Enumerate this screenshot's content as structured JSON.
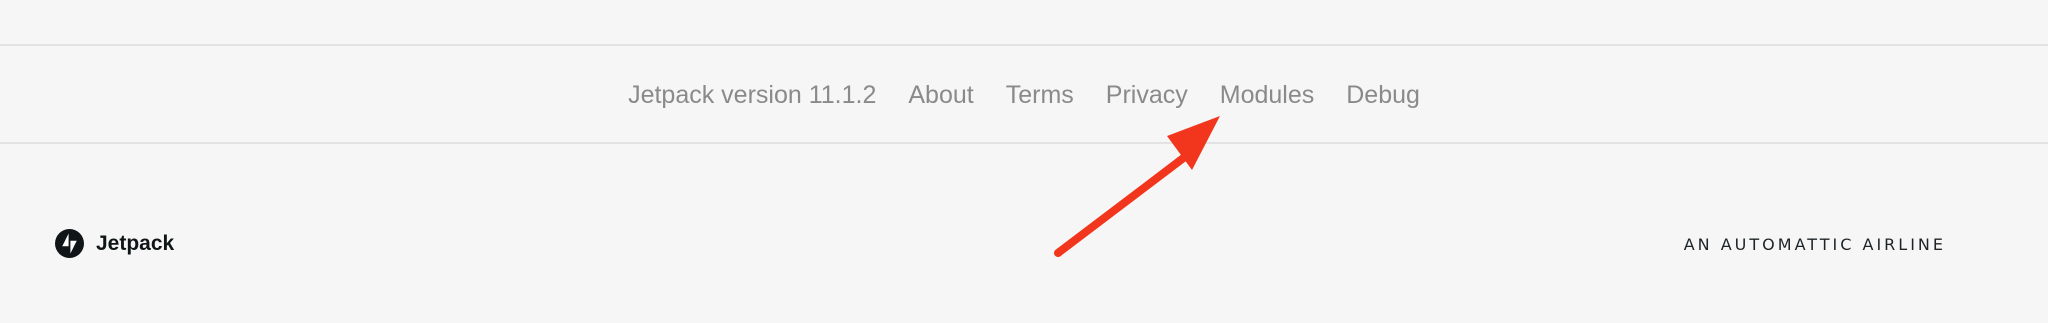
{
  "footer_nav": {
    "version": "Jetpack version 11.1.2",
    "links": [
      "About",
      "Terms",
      "Privacy",
      "Modules",
      "Debug"
    ]
  },
  "brand": {
    "name": "Jetpack",
    "icon": "jetpack-bolt-icon"
  },
  "tagline": "AN AUTOMATTIC AIRLINE",
  "colors": {
    "background": "#f6f6f6",
    "link": "#8a8a8a",
    "arrow": "#f2361d",
    "brand_text": "#101517"
  }
}
